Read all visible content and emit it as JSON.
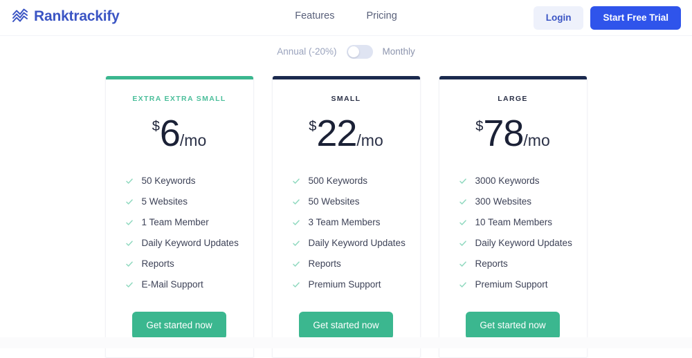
{
  "header": {
    "brand_name": "Ranktrackify",
    "brand_icon": "chart-zigzag-icon",
    "brand_color": "#3b55c4",
    "nav": [
      {
        "label": "Features",
        "name": "nav-link-features"
      },
      {
        "label": "Pricing",
        "name": "nav-link-pricing"
      }
    ],
    "login_label": "Login",
    "trial_label": "Start Free Trial",
    "login_color": "#3b55c4",
    "trial_color": "#2f54eb"
  },
  "billing": {
    "annual_label": "Annual (-20%)",
    "monthly_label": "Monthly",
    "selected": "Annual (-20%)",
    "toggle_state": "off"
  },
  "plans": [
    {
      "name": "EXTRA EXTRA SMALL",
      "accent": "#3bb78f",
      "name_color": "#4cbf9b",
      "currency": "$",
      "amount": "6",
      "period": "/mo",
      "features": [
        "50 Keywords",
        "5 Websites",
        "1 Team Member",
        "Daily Keyword Updates",
        "Reports",
        "E-Mail Support"
      ],
      "cta_label": "Get started now"
    },
    {
      "name": "SMALL",
      "accent": "#1b2a4e",
      "name_color": "#2a3046",
      "currency": "$",
      "amount": "22",
      "period": "/mo",
      "features": [
        "500 Keywords",
        "50 Websites",
        "3 Team Members",
        "Daily Keyword Updates",
        "Reports",
        "Premium Support"
      ],
      "cta_label": "Get started now"
    },
    {
      "name": "LARGE",
      "accent": "#1b2a4e",
      "name_color": "#2a3046",
      "currency": "$",
      "amount": "78",
      "period": "/mo",
      "features": [
        "3000 Keywords",
        "300 Websites",
        "10 Team Members",
        "Daily Keyword Updates",
        "Reports",
        "Premium Support"
      ],
      "cta_label": "Get started now"
    }
  ],
  "icons": {
    "check": "check-icon",
    "check_color": "#8fd9bf"
  }
}
